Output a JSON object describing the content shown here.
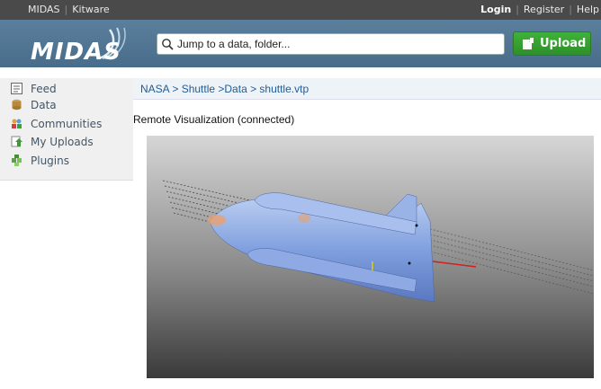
{
  "topbar": {
    "brand": "MIDAS",
    "vendor": "Kitware",
    "login": "Login",
    "register": "Register",
    "help": "Help"
  },
  "header": {
    "logo_text": "MIDAS",
    "search": {
      "placeholder": "Jump to a data, folder..."
    },
    "upload_label": "Upload"
  },
  "sidebar": {
    "items": [
      {
        "label": "Feed",
        "icon": "feed-icon"
      },
      {
        "label": "Data",
        "icon": "data-icon"
      },
      {
        "label": "Communities",
        "icon": "communities-icon"
      },
      {
        "label": "My Uploads",
        "icon": "uploads-icon"
      },
      {
        "label": "Plugins",
        "icon": "plugins-icon"
      }
    ]
  },
  "breadcrumb": "NASA > Shuttle >Data > shuttle.vtp",
  "viewer": {
    "title": "Remote Visualization (connected)"
  },
  "colors": {
    "topbar": "#4a4a4a",
    "header": "#52768f",
    "upload": "#36a132",
    "link": "#1f5c99"
  }
}
